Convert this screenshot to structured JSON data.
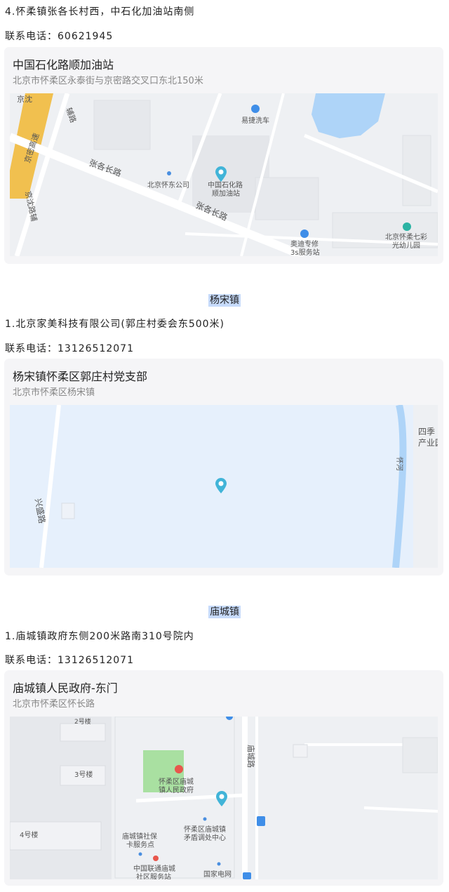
{
  "top": {
    "line1": "4.怀柔镇张各长村西，中石化加油站南侧",
    "phone": "联系电话：60621945"
  },
  "card1": {
    "name": "中国石化路顺加油站",
    "address": "北京市怀柔区永泰街与京密路交叉口东北150米",
    "map_labels": {
      "jingshen": "京沈",
      "jingmi": "京密高速",
      "fulu": "辅路",
      "zhangge1": "张各长路",
      "zhangge2": "张各长路",
      "huaidong": "北京怀东公司",
      "station1": "中国石化路",
      "station2": "顺加油站",
      "carwash": "易捷洗车",
      "audi1": "奥迪专修",
      "audi2": "3s服务站",
      "school1": "北京怀柔七彩",
      "school2": "光幼儿园",
      "jingshenfulu": "京沈路辅"
    }
  },
  "section2": {
    "title": "杨宋镇",
    "line1": "1.北京家美科技有限公司(郭庄村委会东500米)",
    "phone": "联系电话：13126512071"
  },
  "card2": {
    "name": "杨宋镇怀柔区郭庄村党支部",
    "address": "北京市怀柔区杨宋镇",
    "map_labels": {
      "xingsheng": "兴盛路",
      "river": "怀河",
      "siji1": "四季",
      "siji2": "产业园"
    }
  },
  "section3": {
    "title": "庙城镇",
    "line1": "1.庙城镇政府东侧200米路南310号院内",
    "phone": "联系电话：13126512071"
  },
  "card3": {
    "name": "庙城镇人民政府-东门",
    "address": "北京市怀柔区怀长路",
    "map_labels": {
      "bldg2": "2号楼",
      "bldg3": "3号楼",
      "bldg4": "4号楼",
      "miaocheng_road": "庙城路",
      "gov1": "怀柔区庙城",
      "gov2": "镇人民政府",
      "social1": "庙城镇社保",
      "social2": "卡服务点",
      "unicom1": "中国联通庙城",
      "unicom2": "社区服务站",
      "mediate1": "怀柔区庙城镇",
      "mediate2": "矛盾调处中心",
      "grid": "国家电网"
    }
  },
  "colors": {
    "highlight": "#c7dbfb",
    "pin": "#41b4d8",
    "water": "#aed4f8",
    "highway": "#f1c04f"
  }
}
